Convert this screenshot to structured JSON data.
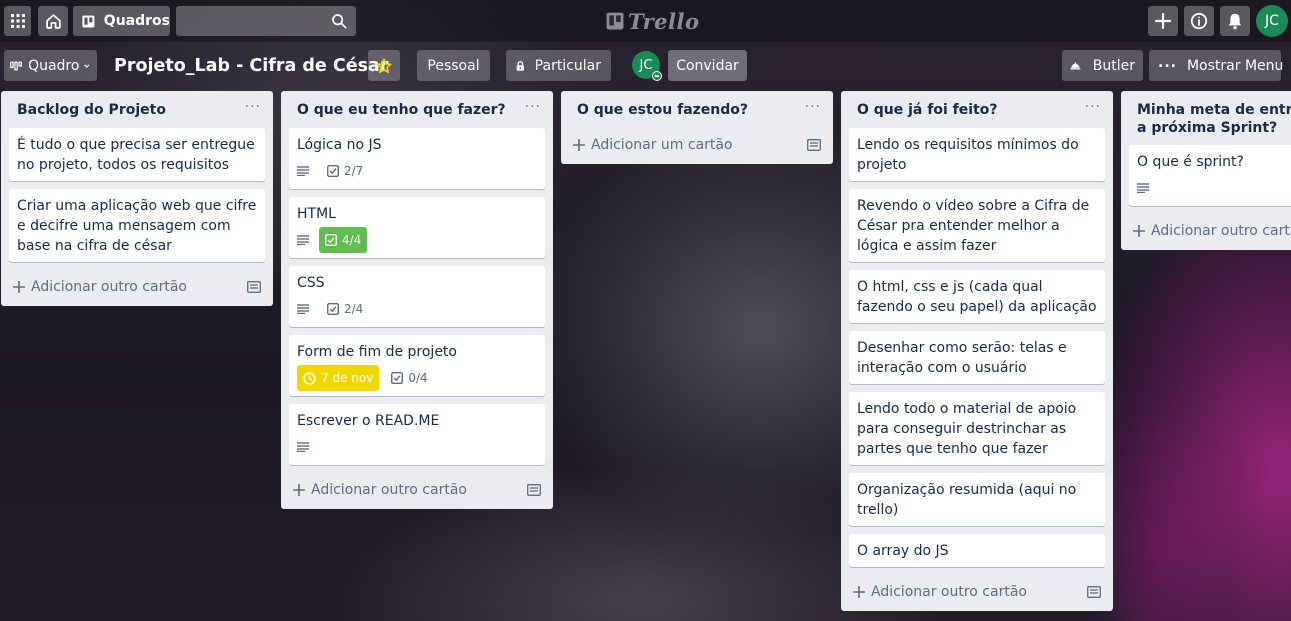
{
  "header": {
    "boards_label": "Quadros",
    "search_placeholder": "",
    "logo_text": "Trello",
    "avatar_initials": "JC"
  },
  "board": {
    "view_label": "Quadro",
    "title": "Projeto_Lab - Cifra de César",
    "team_label": "Pessoal",
    "visibility_label": "Particular",
    "member_initials": "JC",
    "invite_label": "Convidar",
    "butler_label": "Butler",
    "menu_label": "Mostrar Menu"
  },
  "lists": [
    {
      "title": "Backlog do Projeto",
      "menu": "···",
      "cards": [
        {
          "title": "É tudo o que precisa ser entregue no projeto, todos os requisitos"
        },
        {
          "title": "Criar uma aplicação web que cifre e decifre uma mensagem com base na cifra de césar"
        }
      ],
      "add_label": "Adicionar outro cartão"
    },
    {
      "title": "O que eu tenho que fazer?",
      "menu": "···",
      "cards": [
        {
          "title": "Lógica no JS",
          "checklist": "2/7"
        },
        {
          "title": "HTML",
          "checklist": "4/4"
        },
        {
          "title": "CSS",
          "checklist": "2/4"
        },
        {
          "title": "Form de fim de projeto",
          "due": "7 de nov",
          "checklist": "0/4"
        },
        {
          "title": "Escrever o READ.ME"
        }
      ],
      "add_label": "Adicionar outro cartão"
    },
    {
      "title": "O que estou fazendo?",
      "menu": "···",
      "cards": [],
      "add_label": "Adicionar um cartão"
    },
    {
      "title": "O que já foi feito?",
      "menu": "···",
      "cards": [
        {
          "title": "Lendo os requisitos mínimos do projeto"
        },
        {
          "title": "Revendo o vídeo sobre a Cifra de César pra entender melhor a lógica e assim fazer"
        },
        {
          "title": "O html, css e js (cada qual fazendo o seu papel) da aplicação"
        },
        {
          "title": "Desenhar como serão: telas e interação com o usuário"
        },
        {
          "title": "Lendo todo o material de apoio para conseguir destrinchar as partes que tenho que fazer"
        },
        {
          "title": "Organização resumida (aqui no trello)"
        },
        {
          "title": "O array do JS"
        }
      ],
      "add_label": "Adicionar outro cartão"
    },
    {
      "title": "Minha meta de entrega para a próxima Sprint?",
      "menu": "···",
      "cards": [
        {
          "title": "O que é sprint?"
        }
      ],
      "add_label": "Adicionar outro cartão"
    }
  ],
  "colors": {
    "list_bg": "#ebecf0",
    "checklist_complete": "#61bd4f",
    "due_soon": "#f2d600",
    "avatar": "#1a8a57"
  }
}
